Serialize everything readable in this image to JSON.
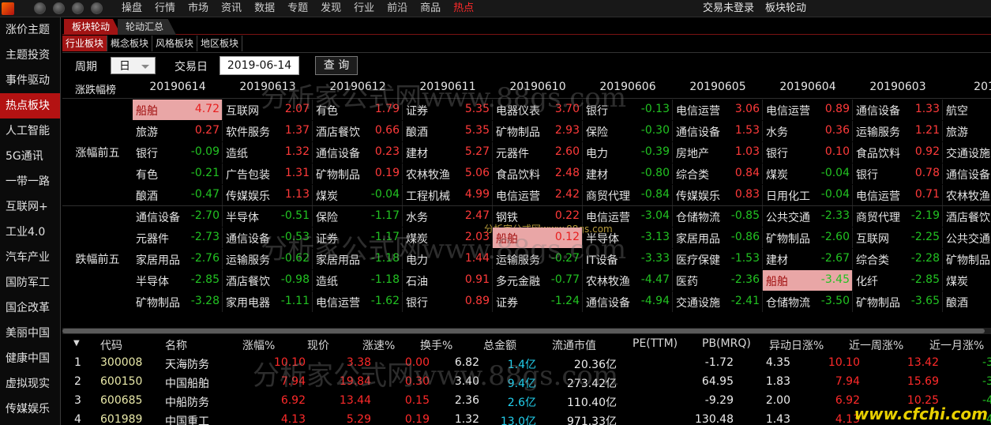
{
  "menu": [
    "操盘",
    "行情",
    "市场",
    "资讯",
    "数据",
    "专题",
    "发现",
    "行业",
    "前沿",
    "商品",
    "热点"
  ],
  "menu_active": 10,
  "top_right": {
    "login_status": "交易未登录",
    "module_title": "板块轮动"
  },
  "sidebar": [
    "涨价主题",
    "主题投资",
    "事件驱动",
    "热点板块",
    "人工智能",
    "5G通讯",
    "一带一路",
    "互联网+",
    "工业4.0",
    "汽车产业",
    "国防军工",
    "国企改革",
    "美丽中国",
    "健康中国",
    "虚拟现实",
    "传媒娱乐"
  ],
  "sidebar_active": 3,
  "tabs_primary": [
    "板块轮动",
    "轮动汇总"
  ],
  "tabs_secondary": [
    "行业板块",
    "概念板块",
    "风格板块",
    "地区板块"
  ],
  "filter": {
    "period_label": "周期",
    "period_value": "日",
    "date_label": "交易日",
    "date_value": "2019-06-14",
    "query_label": "查 询"
  },
  "rank": {
    "title": "涨跌幅榜",
    "dates": [
      "20190614",
      "20190613",
      "20190612",
      "20190611",
      "20190610",
      "20190606",
      "20190605",
      "20190604",
      "20190603",
      "2019"
    ],
    "gainers_label": "涨幅前五",
    "losers_label": "跌幅前五",
    "gainers": [
      [
        [
          "船舶",
          "4.72"
        ],
        [
          "旅游",
          "0.27"
        ],
        [
          "银行",
          "-0.09"
        ],
        [
          "有色",
          "-0.21"
        ],
        [
          "酿酒",
          "-0.47"
        ]
      ],
      [
        [
          "互联网",
          "2.07"
        ],
        [
          "软件服务",
          "1.37"
        ],
        [
          "造纸",
          "1.32"
        ],
        [
          "广告包装",
          "1.31"
        ],
        [
          "传媒娱乐",
          "1.13"
        ]
      ],
      [
        [
          "有色",
          "1.79"
        ],
        [
          "酒店餐饮",
          "0.66"
        ],
        [
          "通信设备",
          "0.23"
        ],
        [
          "矿物制品",
          "0.19"
        ],
        [
          "煤炭",
          "-0.04"
        ]
      ],
      [
        [
          "证券",
          "5.35"
        ],
        [
          "酿酒",
          "5.35"
        ],
        [
          "建材",
          "5.27"
        ],
        [
          "农林牧渔",
          "5.06"
        ],
        [
          "工程机械",
          "4.99"
        ]
      ],
      [
        [
          "电器仪表",
          "3.70"
        ],
        [
          "矿物制品",
          "2.93"
        ],
        [
          "元器件",
          "2.60"
        ],
        [
          "食品饮料",
          "2.48"
        ],
        [
          "电信运营",
          "2.42"
        ]
      ],
      [
        [
          "银行",
          "-0.13"
        ],
        [
          "保险",
          "-0.30"
        ],
        [
          "电力",
          "-0.39"
        ],
        [
          "建材",
          "-0.80"
        ],
        [
          "商贸代理",
          "-0.84"
        ]
      ],
      [
        [
          "电信运营",
          "3.06"
        ],
        [
          "通信设备",
          "1.53"
        ],
        [
          "房地产",
          "1.03"
        ],
        [
          "综合类",
          "0.84"
        ],
        [
          "传媒娱乐",
          "0.83"
        ]
      ],
      [
        [
          "电信运营",
          "0.89"
        ],
        [
          "水务",
          "0.36"
        ],
        [
          "银行",
          "0.10"
        ],
        [
          "煤炭",
          "-0.04"
        ],
        [
          "日用化工",
          "-0.04"
        ]
      ],
      [
        [
          "通信设备",
          "1.33"
        ],
        [
          "运输服务",
          "1.21"
        ],
        [
          "食品饮料",
          "0.92"
        ],
        [
          "银行",
          "0.78"
        ],
        [
          "电信运营",
          "0.71"
        ]
      ],
      [
        [
          "航空",
          ""
        ],
        [
          "旅游",
          ""
        ],
        [
          "交通设施",
          ""
        ],
        [
          "通信设备",
          ""
        ],
        [
          "农林牧渔",
          ""
        ]
      ]
    ],
    "losers": [
      [
        [
          "通信设备",
          "-2.70"
        ],
        [
          "元器件",
          "-2.73"
        ],
        [
          "家居用品",
          "-2.76"
        ],
        [
          "半导体",
          "-2.85"
        ],
        [
          "矿物制品",
          "-3.28"
        ]
      ],
      [
        [
          "半导体",
          "-0.51"
        ],
        [
          "通信设备",
          "-0.53"
        ],
        [
          "运输服务",
          "-0.62"
        ],
        [
          "酒店餐饮",
          "-0.98"
        ],
        [
          "家用电器",
          "-1.11"
        ]
      ],
      [
        [
          "保险",
          "-1.17"
        ],
        [
          "证券",
          "-1.17"
        ],
        [
          "家居用品",
          "-1.18"
        ],
        [
          "造纸",
          "-1.18"
        ],
        [
          "电信运营",
          "-1.62"
        ]
      ],
      [
        [
          "水务",
          "2.47"
        ],
        [
          "煤炭",
          "2.03"
        ],
        [
          "电力",
          "1.44"
        ],
        [
          "石油",
          "0.91"
        ],
        [
          "银行",
          "0.89"
        ]
      ],
      [
        [
          "钢铁",
          "0.22"
        ],
        [
          "船舶",
          "0.12"
        ],
        [
          "运输服务",
          "-0.27"
        ],
        [
          "多元金融",
          "-0.77"
        ],
        [
          "证券",
          "-1.24"
        ]
      ],
      [
        [
          "电信运营",
          "-3.04"
        ],
        [
          "半导体",
          "-3.13"
        ],
        [
          "IT设备",
          "-3.33"
        ],
        [
          "农林牧渔",
          "-4.47"
        ],
        [
          "通信设备",
          "-4.94"
        ]
      ],
      [
        [
          "仓储物流",
          "-0.85"
        ],
        [
          "家居用品",
          "-0.86"
        ],
        [
          "医疗保健",
          "-1.53"
        ],
        [
          "医药",
          "-2.36"
        ],
        [
          "交通设施",
          "-2.41"
        ]
      ],
      [
        [
          "公共交通",
          "-2.33"
        ],
        [
          "矿物制品",
          "-2.60"
        ],
        [
          "建材",
          "-2.67"
        ],
        [
          "船舶",
          "-3.45"
        ],
        [
          "仓储物流",
          "-3.50"
        ]
      ],
      [
        [
          "商贸代理",
          "-2.19"
        ],
        [
          "互联网",
          "-2.25"
        ],
        [
          "综合类",
          "-2.28"
        ],
        [
          "化纤",
          "-2.85"
        ],
        [
          "矿物制品",
          "-3.65"
        ]
      ],
      [
        [
          "酒店餐饮",
          ""
        ],
        [
          "公共交通",
          ""
        ],
        [
          "矿物制品",
          ""
        ],
        [
          "煤炭",
          ""
        ],
        [
          "酿酒",
          ""
        ]
      ]
    ]
  },
  "table": {
    "headers": [
      "代码",
      "名称",
      "涨幅%",
      "现价",
      "涨速%",
      "换手%",
      "总金额",
      "流通市值",
      "PE(TTM)",
      "PB(MRQ)",
      "异动日涨%",
      "近一周涨%",
      "近一月涨%"
    ],
    "rows": [
      [
        "1",
        "300008",
        "天海防务",
        "10.10",
        "3.38",
        "0.00",
        "6.82",
        "1.4亿",
        "20.36亿",
        "-1.72",
        "4.35",
        "10.10",
        "13.42",
        "-3"
      ],
      [
        "2",
        "600150",
        "中国船舶",
        "7.94",
        "19.84",
        "0.30",
        "3.40",
        "9.4亿",
        "273.42亿",
        "64.95",
        "1.83",
        "7.94",
        "15.69",
        "-3"
      ],
      [
        "3",
        "600685",
        "中船防务",
        "6.92",
        "13.44",
        "0.15",
        "2.36",
        "2.6亿",
        "110.40亿",
        "-9.29",
        "2.00",
        "6.92",
        "10.25",
        "-4"
      ],
      [
        "4",
        "601989",
        "中国重工",
        "4.13",
        "5.29",
        "0.19",
        "1.32",
        "13.0亿",
        "971.33亿",
        "130.48",
        "1.43",
        "4.13",
        "",
        "-4"
      ]
    ]
  },
  "watermarks": {
    "main": "分析家公式网www.88gs.com",
    "small": "分析家公式网www.88gs.com",
    "corner": "www.cfchi.com"
  },
  "colors": {
    "up": "#ff3a3a",
    "down": "#22c222",
    "accent": "#a11414",
    "highlight": "#e9a6a6"
  }
}
